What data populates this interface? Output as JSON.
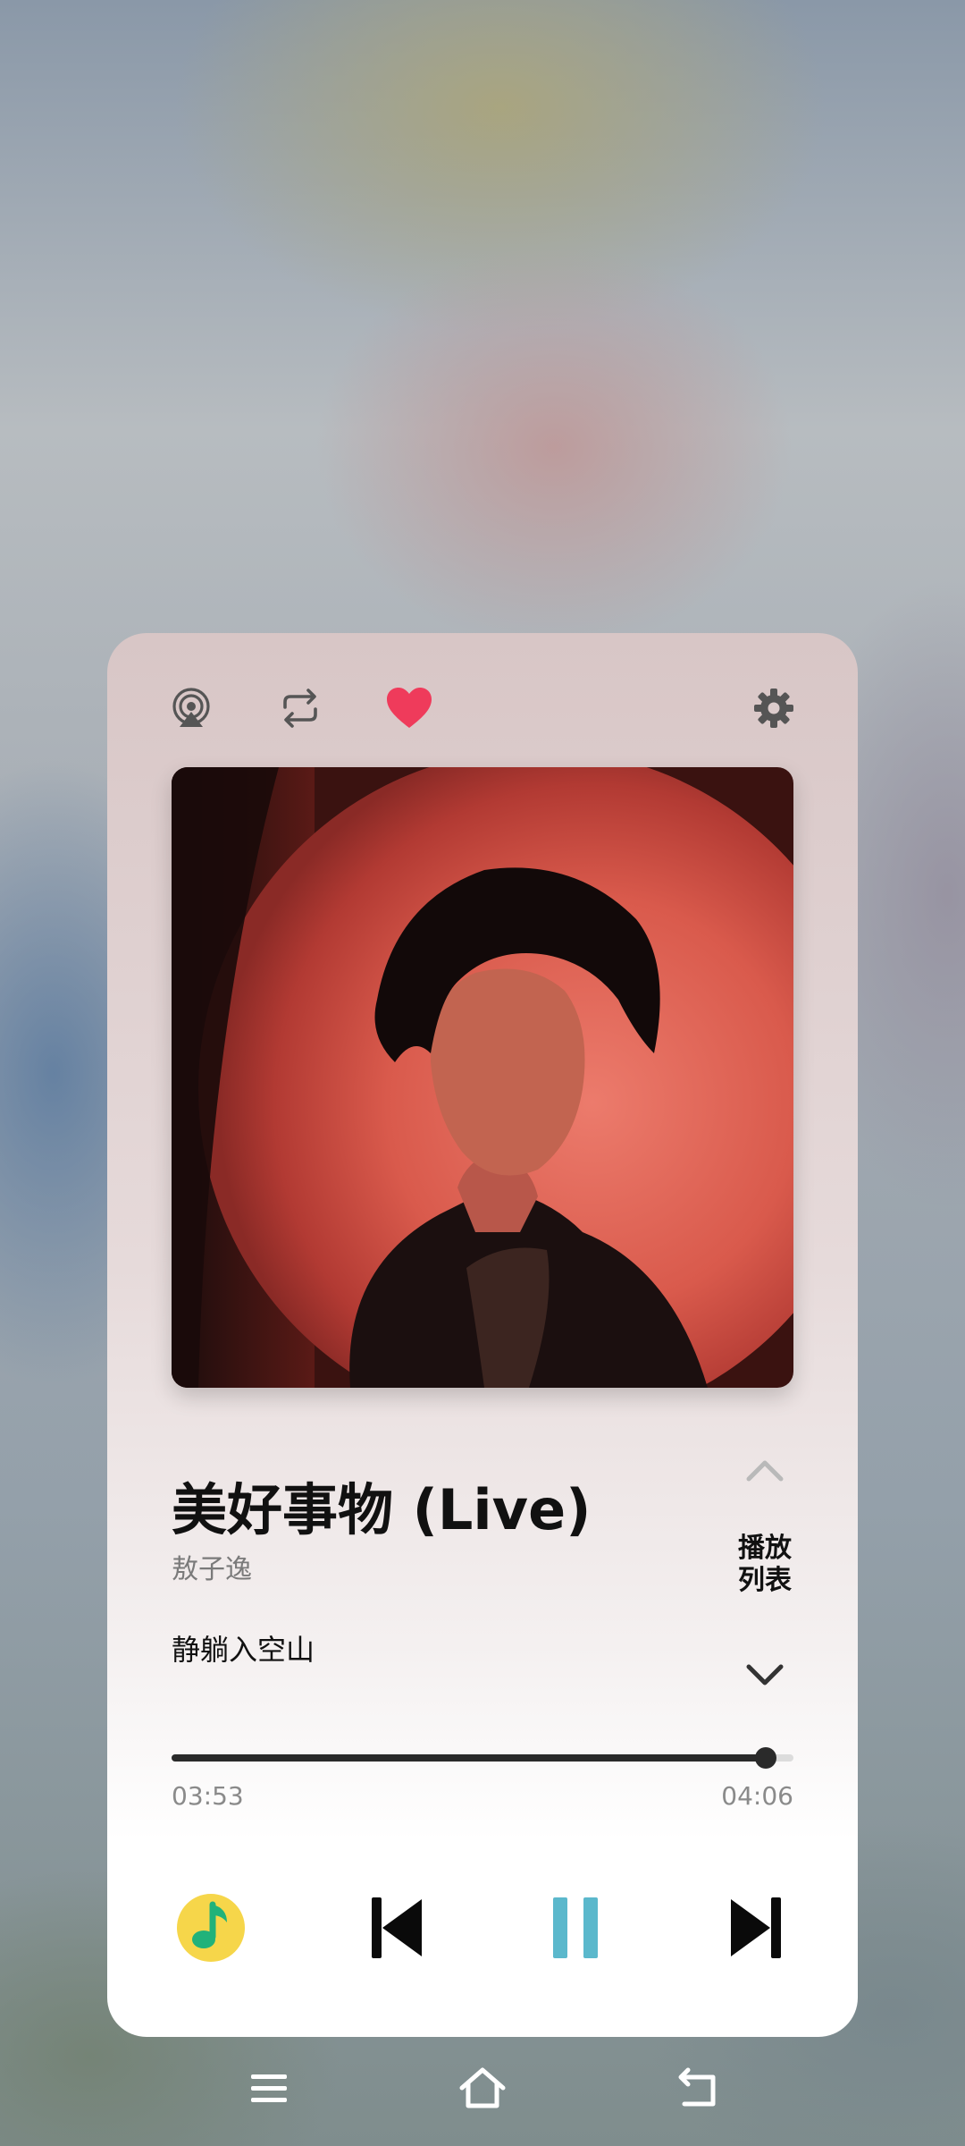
{
  "player": {
    "song_title": "美好事物 (Live)",
    "artist": "敖子逸",
    "lyric_line": "静躺入空山",
    "playlist_label": "播放列表",
    "elapsed": "03:53",
    "duration": "04:06",
    "progress_fraction": 0.955,
    "liked": true
  },
  "icons": {
    "top": [
      "airplay-icon",
      "repeat-icon",
      "heart-icon",
      "gear-icon"
    ],
    "controls": [
      "qq-music-app-icon",
      "previous-track-icon",
      "pause-icon",
      "next-track-icon"
    ],
    "nav": [
      "menu-icon",
      "home-icon",
      "back-icon"
    ]
  },
  "colors": {
    "heart": "#ef3b5b",
    "pause_accent": "#5bb8cc",
    "app_icon_yellow": "#f6d64a",
    "app_icon_green": "#21b27a"
  }
}
